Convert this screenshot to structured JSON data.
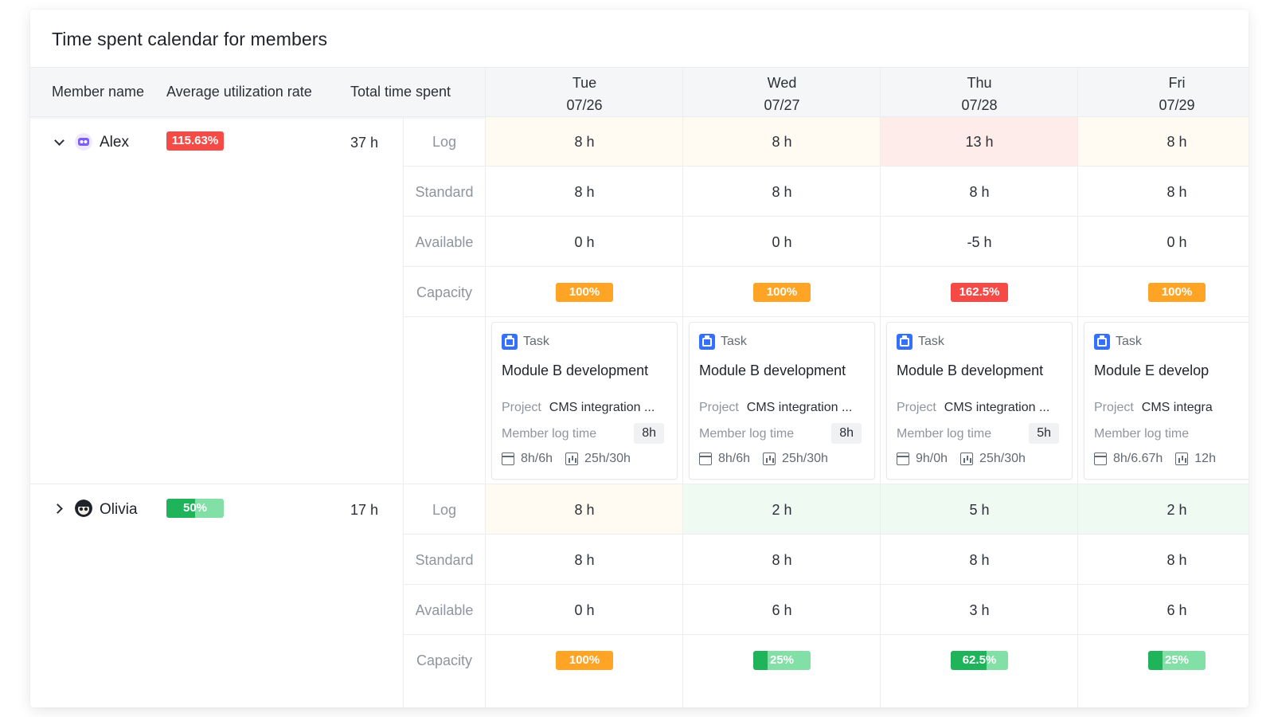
{
  "title": "Time spent calendar for members",
  "columns": {
    "member_name": "Member name",
    "avg_util": "Average utilization rate",
    "total_time": "Total time spent"
  },
  "days": [
    {
      "dow": "Tue",
      "date": "07/26"
    },
    {
      "dow": "Wed",
      "date": "07/27"
    },
    {
      "dow": "Thu",
      "date": "07/28"
    },
    {
      "dow": "Fri",
      "date": "07/29"
    }
  ],
  "row_labels": {
    "log": "Log",
    "standard": "Standard",
    "available": "Available",
    "capacity": "Capacity"
  },
  "colors": {
    "orange": "#ffa424",
    "red": "#f54a45",
    "green": "#1fb35a",
    "warn_bg": "#fdecea",
    "normal_bg": "#fffbf2",
    "under_bg": "#eefaf2"
  },
  "members": [
    {
      "name": "Alex",
      "avatar_icon": "purple-avatar-icon",
      "util": "115.63%",
      "total": "37 h",
      "expanded": true,
      "log": [
        "8 h",
        "8 h",
        "13 h",
        "8 h"
      ],
      "standard": [
        "8 h",
        "8 h",
        "8 h",
        "8 h"
      ],
      "available": [
        "0 h",
        "0 h",
        "-5 h",
        "0 h"
      ],
      "capacity": [
        "100%",
        "100%",
        "162.5%",
        "100%"
      ],
      "tasks": [
        {
          "type": "Task",
          "name": "Module B development",
          "project_label": "Project",
          "project": "CMS integration ...",
          "log_label": "Member log time",
          "log": "8h",
          "hours": "8h/6h",
          "total": "25h/30h"
        },
        {
          "type": "Task",
          "name": "Module B development",
          "project_label": "Project",
          "project": "CMS integration ...",
          "log_label": "Member log time",
          "log": "8h",
          "hours": "8h/6h",
          "total": "25h/30h"
        },
        {
          "type": "Task",
          "name": "Module B development",
          "project_label": "Project",
          "project": "CMS integration ...",
          "log_label": "Member log time",
          "log": "5h",
          "hours": "9h/0h",
          "total": "25h/30h"
        },
        {
          "type": "Task",
          "name": "Module E develop",
          "project_label": "Project",
          "project": "CMS integra",
          "log_label": "Member log time",
          "log": "",
          "hours": "8h/6.67h",
          "total": "12h"
        }
      ]
    },
    {
      "name": "Olivia",
      "avatar_icon": "dark-avatar-icon",
      "util": "50%",
      "util_fill": 0.5,
      "total": "17 h",
      "expanded": false,
      "log": [
        "8 h",
        "2 h",
        "5 h",
        "2 h"
      ],
      "standard": [
        "8 h",
        "8 h",
        "8 h",
        "8 h"
      ],
      "available": [
        "0 h",
        "6 h",
        "3 h",
        "6 h"
      ],
      "capacity": [
        "100%",
        "25%",
        "62.5%",
        "25%"
      ],
      "capacity_fill": [
        1.0,
        0.25,
        0.625,
        0.25
      ]
    }
  ]
}
